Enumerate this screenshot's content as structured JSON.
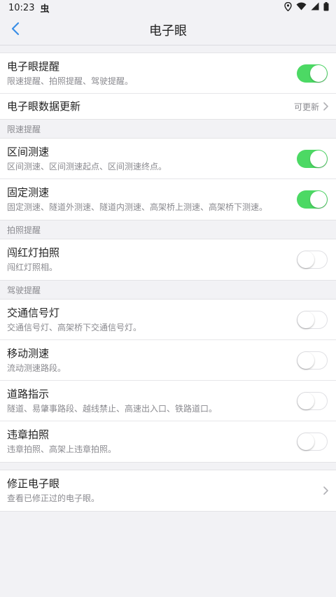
{
  "status_bar": {
    "time": "10:23",
    "app_glyph": "虫",
    "icons": [
      "location-icon",
      "wifi-icon",
      "signal-icon",
      "battery-icon"
    ]
  },
  "nav": {
    "title": "电子眼",
    "back_icon": "chevron-left-icon"
  },
  "colors": {
    "accent": "#3a8ee6",
    "toggle_on": "#4cd964",
    "background": "#f2f2f5"
  },
  "main": {
    "reminder": {
      "title": "电子眼提醒",
      "subtitle": "限速提醒、拍照提醒、驾驶提醒。",
      "enabled": true
    },
    "data_update": {
      "title": "电子眼数据更新",
      "detail": "可更新"
    }
  },
  "sections": {
    "speed": {
      "label": "限速提醒",
      "items": [
        {
          "title": "区间测速",
          "subtitle": "区间测速、区间测速起点、区间测速终点。",
          "enabled": true
        },
        {
          "title": "固定测速",
          "subtitle": "固定测速、隧道外测速、隧道内测速、高架桥上测速、高架桥下测速。",
          "enabled": true
        }
      ]
    },
    "photo": {
      "label": "拍照提醒",
      "items": [
        {
          "title": "闯红灯拍照",
          "subtitle": "闯红灯照相。",
          "enabled": false
        }
      ]
    },
    "driving": {
      "label": "驾驶提醒",
      "items": [
        {
          "title": "交通信号灯",
          "subtitle": "交通信号灯、高架桥下交通信号灯。",
          "enabled": false
        },
        {
          "title": "移动测速",
          "subtitle": "流动测速路段。",
          "enabled": false
        },
        {
          "title": "道路指示",
          "subtitle": "隧道、易肇事路段、越线禁止、高速出入口、铁路道口。",
          "enabled": false
        },
        {
          "title": "违章拍照",
          "subtitle": "违章拍照、高架上违章拍照。",
          "enabled": false
        }
      ]
    }
  },
  "fix": {
    "title": "修正电子眼",
    "subtitle": "查看已修正过的电子眼。"
  }
}
